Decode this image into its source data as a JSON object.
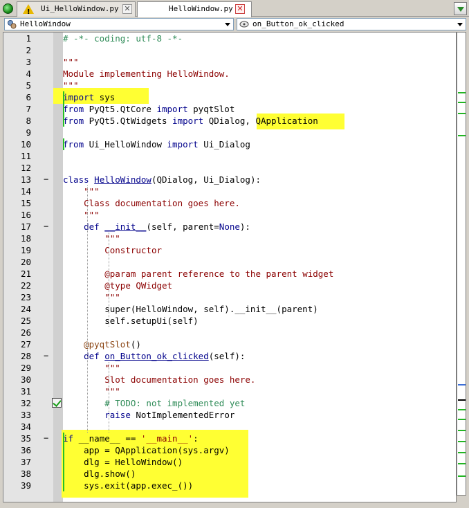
{
  "tabs": [
    {
      "label": "Ui_HelloWindow.py",
      "icon": "warning-icon"
    },
    {
      "label": "HelloWindow.py",
      "icon": "none"
    }
  ],
  "nav": {
    "class_combo": "HelloWindow",
    "method_combo": "on_Button_ok_clicked"
  },
  "lines": [
    {
      "n": "1",
      "html": "<span class='cmt'># -*- coding: utf-8 -*-</span>"
    },
    {
      "n": "2",
      "html": ""
    },
    {
      "n": "3",
      "html": "<span class='str'>\"\"\"</span>"
    },
    {
      "n": "4",
      "html": "<span class='str'>Module implementing HelloWindow.</span>"
    },
    {
      "n": "5",
      "html": "<span class='str'>\"\"\"</span>"
    },
    {
      "n": "6",
      "html": "<span class='kw'>import</span> sys"
    },
    {
      "n": "7",
      "html": "<span class='kw'>from</span> PyQt5.QtCore <span class='kw'>import</span> pyqtSlot"
    },
    {
      "n": "8",
      "html": "<span class='kw'>from</span> PyQt5.QtWidgets <span class='kw'>import</span> QDialog, QApplication"
    },
    {
      "n": "9",
      "html": ""
    },
    {
      "n": "10",
      "html": "<span class='kw'>from</span> Ui_HelloWindow <span class='kw'>import</span> Ui_Dialog"
    },
    {
      "n": "11",
      "html": ""
    },
    {
      "n": "12",
      "html": ""
    },
    {
      "n": "13",
      "html": "<span class='kw'>class</span> <span class='cls'>HelloWindow</span>(QDialog, Ui_Dialog):",
      "fold": "−"
    },
    {
      "n": "14",
      "html": "    <span class='str'>\"\"\"</span>"
    },
    {
      "n": "15",
      "html": "    <span class='str'>Class documentation goes here.</span>"
    },
    {
      "n": "16",
      "html": "    <span class='str'>\"\"\"</span>"
    },
    {
      "n": "17",
      "html": "    <span class='kw'>def</span> <span class='fn'>__init__</span>(self, parent=<span class='kw'>None</span>):",
      "fold": "−"
    },
    {
      "n": "18",
      "html": "        <span class='str'>\"\"\"</span>"
    },
    {
      "n": "19",
      "html": "        <span class='str'>Constructor</span>"
    },
    {
      "n": "20",
      "html": ""
    },
    {
      "n": "21",
      "html": "        <span class='str'>@param parent reference to the parent widget</span>"
    },
    {
      "n": "22",
      "html": "        <span class='str'>@type QWidget</span>"
    },
    {
      "n": "23",
      "html": "        <span class='str'>\"\"\"</span>"
    },
    {
      "n": "24",
      "html": "        super(HelloWindow, self).__init__(parent)"
    },
    {
      "n": "25",
      "html": "        self.setupUi(self)"
    },
    {
      "n": "26",
      "html": ""
    },
    {
      "n": "27",
      "html": "    <span class='dec'>@pyqtSlot</span>()"
    },
    {
      "n": "28",
      "html": "    <span class='kw'>def</span> <span class='fn'>on_Button_ok_clicked</span>(self):",
      "fold": "−"
    },
    {
      "n": "29",
      "html": "        <span class='str'>\"\"\"</span>"
    },
    {
      "n": "30",
      "html": "        <span class='str'>Slot documentation goes here.</span>"
    },
    {
      "n": "31",
      "html": "        <span class='str'>\"\"\"</span>"
    },
    {
      "n": "32",
      "html": "        <span class='cmt'># TODO: not implemented yet</span>",
      "todo": true
    },
    {
      "n": "33",
      "html": "        <span class='kw'>raise</span> NotImplementedError"
    },
    {
      "n": "34",
      "html": ""
    },
    {
      "n": "35",
      "html": "<span class='kw'>if</span> __name__ == <span class='str'>'__main__'</span>:",
      "fold": "−"
    },
    {
      "n": "36",
      "html": "    app = QApplication(sys.argv)"
    },
    {
      "n": "37",
      "html": "    dlg = HelloWindow()"
    },
    {
      "n": "38",
      "html": "    dlg.show()"
    },
    {
      "n": "39",
      "html": "    sys.exit(app.exec_())"
    }
  ]
}
